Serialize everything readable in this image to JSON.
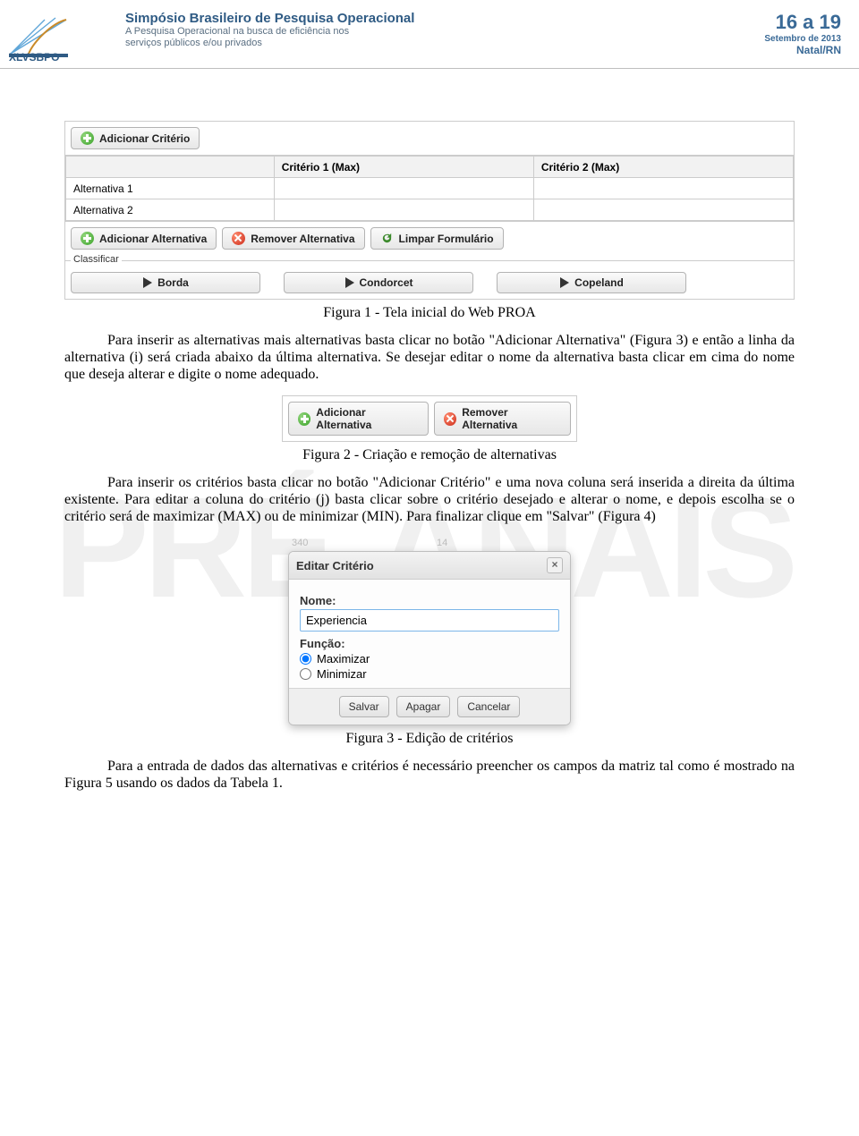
{
  "header": {
    "logo_text_main": "XLVSBPO",
    "title1": "Simpósio Brasileiro de Pesquisa Operacional",
    "title2": "A Pesquisa Operacional na busca de eficiência nos",
    "title3": "serviços públicos e/ou privados",
    "dates": "16 a 19",
    "month": "Setembro de 2013",
    "city": "Natal/RN"
  },
  "watermark": "PRÉ-ANAIS",
  "fig1": {
    "btn_add_crit": "Adicionar Critério",
    "table": {
      "cols": [
        "",
        "Critério 1 (Max)",
        "Critério 2 (Max)"
      ],
      "rows": [
        "Alternativa 1",
        "Alternativa 2"
      ]
    },
    "btn_add_alt": "Adicionar Alternativa",
    "btn_rem_alt": "Remover Alternativa",
    "btn_clear": "Limpar Formulário",
    "classify_label": "Classificar",
    "classify_btns": [
      "Borda",
      "Condorcet",
      "Copeland"
    ],
    "caption": "Figura 1 - Tela inicial do Web PROA"
  },
  "para1": "Para inserir as alternativas mais alternativas basta clicar no botão \"Adicionar Alternativa\" (Figura 3) e então a linha da alternativa (i) será criada abaixo da última alternativa. Se desejar editar o nome da alternativa basta clicar em cima do nome que deseja alterar e digite o nome adequado.",
  "fig2": {
    "btn_add_alt": "Adicionar Alternativa",
    "btn_rem_alt": "Remover Alternativa",
    "caption": "Figura 2 - Criação e remoção de alternativas"
  },
  "para2": "Para inserir os critérios basta clicar no botão \"Adicionar Critério\" e uma nova coluna será inserida a direita da última existente. Para editar a coluna do critério (j) basta clicar sobre o critério desejado e alterar o nome, e depois escolha se o critério será de maximizar (MAX) ou de minimizar (MIN). Para finalizar clique em \"Salvar\" (Figura 4)",
  "fig3": {
    "toprow": [
      "340",
      "14"
    ],
    "dialog_title": "Editar Critério",
    "label_name": "Nome:",
    "input_value": "Experiencia",
    "label_func": "Função:",
    "opt_max": "Maximizar",
    "opt_min": "Minimizar",
    "btn_save": "Salvar",
    "btn_delete": "Apagar",
    "btn_cancel": "Cancelar",
    "caption": "Figura 3 - Edição de critérios"
  },
  "para3": "Para a entrada de dados das alternativas e critérios é necessário preencher os campos da matriz tal como é mostrado na Figura 5 usando os dados da Tabela 1."
}
